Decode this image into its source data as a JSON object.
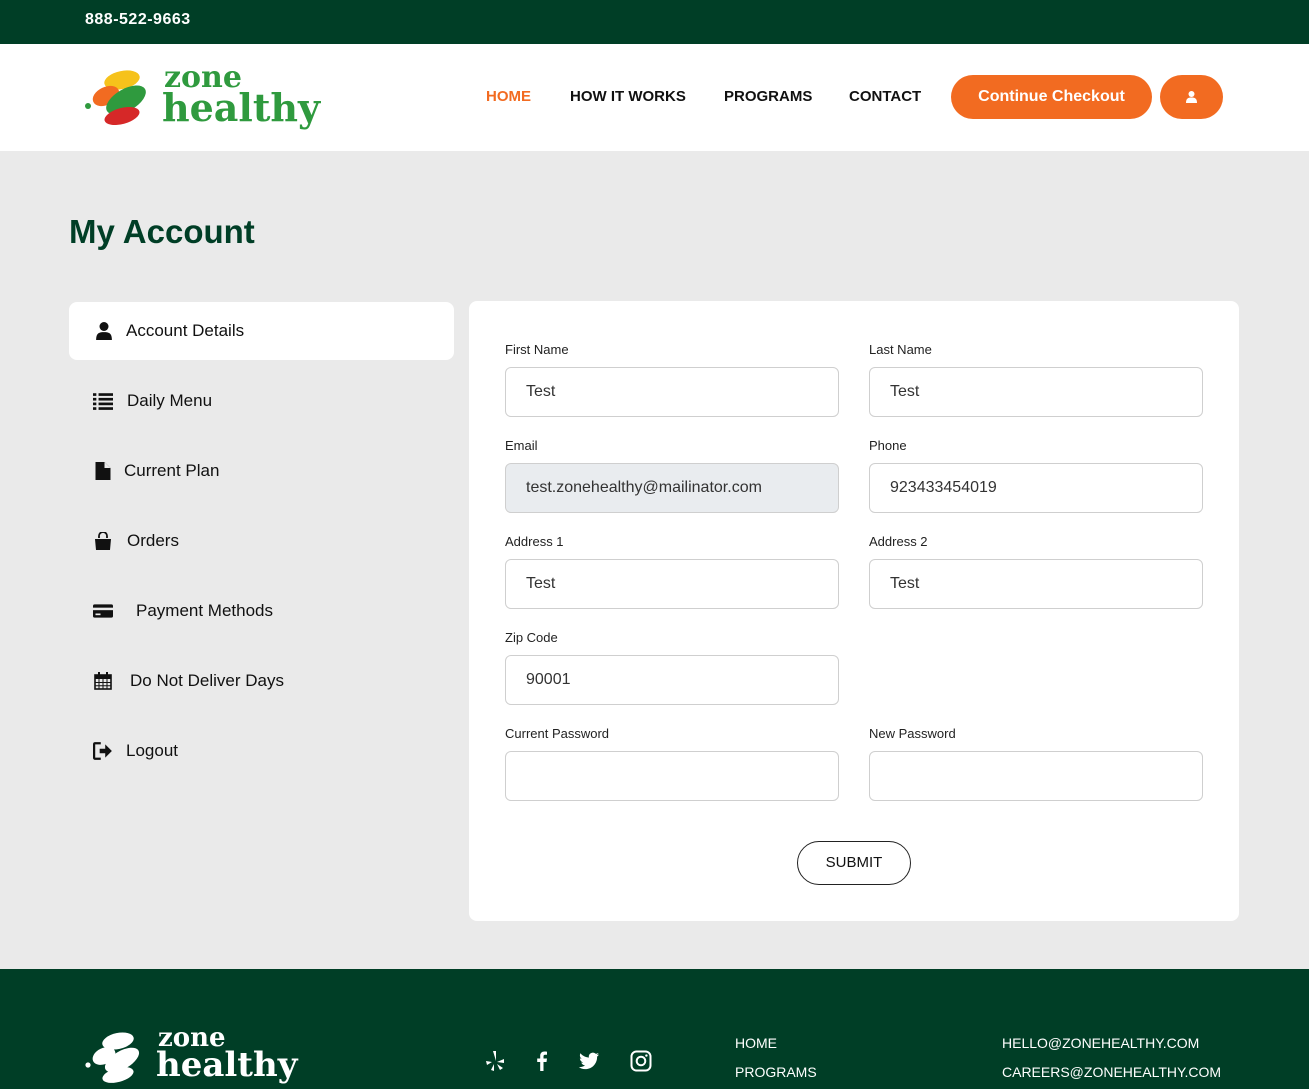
{
  "topbar": {
    "phone": "888-522-9663"
  },
  "brand": {
    "line1": "zone",
    "line2": "healthy"
  },
  "nav": {
    "items": [
      {
        "label": "HOME",
        "active": true
      },
      {
        "label": "HOW IT WORKS",
        "active": false
      },
      {
        "label": "PROGRAMS",
        "active": false
      },
      {
        "label": "CONTACT",
        "active": false
      }
    ],
    "checkout_label": "Continue Checkout",
    "user_icon": "user-icon"
  },
  "page": {
    "title": "My Account"
  },
  "sidebar": {
    "items": [
      {
        "label": "Account Details",
        "icon": "user-icon",
        "active": true
      },
      {
        "label": "Daily Menu",
        "icon": "list-icon",
        "active": false
      },
      {
        "label": "Current Plan",
        "icon": "file-icon",
        "active": false
      },
      {
        "label": "Orders",
        "icon": "shopping-bag-icon",
        "active": false
      },
      {
        "label": "Payment Methods",
        "icon": "credit-card-icon",
        "active": false
      },
      {
        "label": "Do Not Deliver Days",
        "icon": "calendar-icon",
        "active": false
      },
      {
        "label": "Logout",
        "icon": "sign-out-icon",
        "active": false
      }
    ]
  },
  "form": {
    "first_name": {
      "label": "First Name",
      "value": "Test"
    },
    "last_name": {
      "label": "Last Name",
      "value": "Test"
    },
    "email": {
      "label": "Email",
      "value": "test.zonehealthy@mailinator.com",
      "disabled": true
    },
    "phone": {
      "label": "Phone",
      "value": "923433454019"
    },
    "address1": {
      "label": "Address 1",
      "value": "Test"
    },
    "address2": {
      "label": "Address 2",
      "value": "Test"
    },
    "zip": {
      "label": "Zip Code",
      "value": "90001"
    },
    "current_password": {
      "label": "Current Password",
      "value": ""
    },
    "new_password": {
      "label": "New Password",
      "value": ""
    },
    "submit_label": "SUBMIT"
  },
  "footer": {
    "social": [
      "yelp-icon",
      "facebook-icon",
      "twitter-icon",
      "instagram-icon"
    ],
    "links": [
      "HOME",
      "PROGRAMS"
    ],
    "emails": [
      "HELLO@ZONEHEALTHY.COM",
      "CAREERS@ZONEHEALTHY.COM"
    ]
  },
  "colors": {
    "dark_green": "#003e26",
    "accent_orange": "#f26b21",
    "brand_green": "#2f9a3e",
    "page_bg": "#eaeaea"
  }
}
